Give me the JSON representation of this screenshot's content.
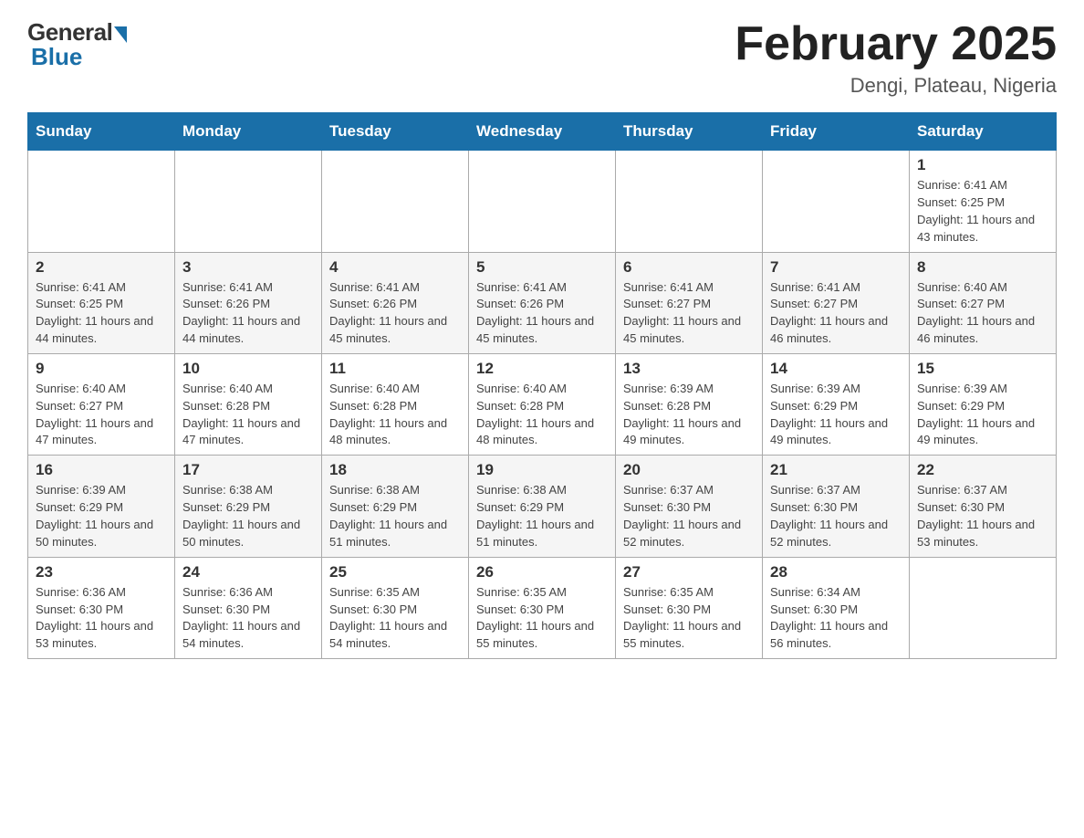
{
  "header": {
    "logo_general": "General",
    "logo_blue": "Blue",
    "month_title": "February 2025",
    "location": "Dengi, Plateau, Nigeria"
  },
  "weekdays": [
    "Sunday",
    "Monday",
    "Tuesday",
    "Wednesday",
    "Thursday",
    "Friday",
    "Saturday"
  ],
  "weeks": [
    [
      {
        "day": "",
        "sunrise": "",
        "sunset": "",
        "daylight": "",
        "empty": true
      },
      {
        "day": "",
        "sunrise": "",
        "sunset": "",
        "daylight": "",
        "empty": true
      },
      {
        "day": "",
        "sunrise": "",
        "sunset": "",
        "daylight": "",
        "empty": true
      },
      {
        "day": "",
        "sunrise": "",
        "sunset": "",
        "daylight": "",
        "empty": true
      },
      {
        "day": "",
        "sunrise": "",
        "sunset": "",
        "daylight": "",
        "empty": true
      },
      {
        "day": "",
        "sunrise": "",
        "sunset": "",
        "daylight": "",
        "empty": true
      },
      {
        "day": "1",
        "sunrise": "Sunrise: 6:41 AM",
        "sunset": "Sunset: 6:25 PM",
        "daylight": "Daylight: 11 hours and 43 minutes.",
        "empty": false
      }
    ],
    [
      {
        "day": "2",
        "sunrise": "Sunrise: 6:41 AM",
        "sunset": "Sunset: 6:25 PM",
        "daylight": "Daylight: 11 hours and 44 minutes.",
        "empty": false
      },
      {
        "day": "3",
        "sunrise": "Sunrise: 6:41 AM",
        "sunset": "Sunset: 6:26 PM",
        "daylight": "Daylight: 11 hours and 44 minutes.",
        "empty": false
      },
      {
        "day": "4",
        "sunrise": "Sunrise: 6:41 AM",
        "sunset": "Sunset: 6:26 PM",
        "daylight": "Daylight: 11 hours and 45 minutes.",
        "empty": false
      },
      {
        "day": "5",
        "sunrise": "Sunrise: 6:41 AM",
        "sunset": "Sunset: 6:26 PM",
        "daylight": "Daylight: 11 hours and 45 minutes.",
        "empty": false
      },
      {
        "day": "6",
        "sunrise": "Sunrise: 6:41 AM",
        "sunset": "Sunset: 6:27 PM",
        "daylight": "Daylight: 11 hours and 45 minutes.",
        "empty": false
      },
      {
        "day": "7",
        "sunrise": "Sunrise: 6:41 AM",
        "sunset": "Sunset: 6:27 PM",
        "daylight": "Daylight: 11 hours and 46 minutes.",
        "empty": false
      },
      {
        "day": "8",
        "sunrise": "Sunrise: 6:40 AM",
        "sunset": "Sunset: 6:27 PM",
        "daylight": "Daylight: 11 hours and 46 minutes.",
        "empty": false
      }
    ],
    [
      {
        "day": "9",
        "sunrise": "Sunrise: 6:40 AM",
        "sunset": "Sunset: 6:27 PM",
        "daylight": "Daylight: 11 hours and 47 minutes.",
        "empty": false
      },
      {
        "day": "10",
        "sunrise": "Sunrise: 6:40 AM",
        "sunset": "Sunset: 6:28 PM",
        "daylight": "Daylight: 11 hours and 47 minutes.",
        "empty": false
      },
      {
        "day": "11",
        "sunrise": "Sunrise: 6:40 AM",
        "sunset": "Sunset: 6:28 PM",
        "daylight": "Daylight: 11 hours and 48 minutes.",
        "empty": false
      },
      {
        "day": "12",
        "sunrise": "Sunrise: 6:40 AM",
        "sunset": "Sunset: 6:28 PM",
        "daylight": "Daylight: 11 hours and 48 minutes.",
        "empty": false
      },
      {
        "day": "13",
        "sunrise": "Sunrise: 6:39 AM",
        "sunset": "Sunset: 6:28 PM",
        "daylight": "Daylight: 11 hours and 49 minutes.",
        "empty": false
      },
      {
        "day": "14",
        "sunrise": "Sunrise: 6:39 AM",
        "sunset": "Sunset: 6:29 PM",
        "daylight": "Daylight: 11 hours and 49 minutes.",
        "empty": false
      },
      {
        "day": "15",
        "sunrise": "Sunrise: 6:39 AM",
        "sunset": "Sunset: 6:29 PM",
        "daylight": "Daylight: 11 hours and 49 minutes.",
        "empty": false
      }
    ],
    [
      {
        "day": "16",
        "sunrise": "Sunrise: 6:39 AM",
        "sunset": "Sunset: 6:29 PM",
        "daylight": "Daylight: 11 hours and 50 minutes.",
        "empty": false
      },
      {
        "day": "17",
        "sunrise": "Sunrise: 6:38 AM",
        "sunset": "Sunset: 6:29 PM",
        "daylight": "Daylight: 11 hours and 50 minutes.",
        "empty": false
      },
      {
        "day": "18",
        "sunrise": "Sunrise: 6:38 AM",
        "sunset": "Sunset: 6:29 PM",
        "daylight": "Daylight: 11 hours and 51 minutes.",
        "empty": false
      },
      {
        "day": "19",
        "sunrise": "Sunrise: 6:38 AM",
        "sunset": "Sunset: 6:29 PM",
        "daylight": "Daylight: 11 hours and 51 minutes.",
        "empty": false
      },
      {
        "day": "20",
        "sunrise": "Sunrise: 6:37 AM",
        "sunset": "Sunset: 6:30 PM",
        "daylight": "Daylight: 11 hours and 52 minutes.",
        "empty": false
      },
      {
        "day": "21",
        "sunrise": "Sunrise: 6:37 AM",
        "sunset": "Sunset: 6:30 PM",
        "daylight": "Daylight: 11 hours and 52 minutes.",
        "empty": false
      },
      {
        "day": "22",
        "sunrise": "Sunrise: 6:37 AM",
        "sunset": "Sunset: 6:30 PM",
        "daylight": "Daylight: 11 hours and 53 minutes.",
        "empty": false
      }
    ],
    [
      {
        "day": "23",
        "sunrise": "Sunrise: 6:36 AM",
        "sunset": "Sunset: 6:30 PM",
        "daylight": "Daylight: 11 hours and 53 minutes.",
        "empty": false
      },
      {
        "day": "24",
        "sunrise": "Sunrise: 6:36 AM",
        "sunset": "Sunset: 6:30 PM",
        "daylight": "Daylight: 11 hours and 54 minutes.",
        "empty": false
      },
      {
        "day": "25",
        "sunrise": "Sunrise: 6:35 AM",
        "sunset": "Sunset: 6:30 PM",
        "daylight": "Daylight: 11 hours and 54 minutes.",
        "empty": false
      },
      {
        "day": "26",
        "sunrise": "Sunrise: 6:35 AM",
        "sunset": "Sunset: 6:30 PM",
        "daylight": "Daylight: 11 hours and 55 minutes.",
        "empty": false
      },
      {
        "day": "27",
        "sunrise": "Sunrise: 6:35 AM",
        "sunset": "Sunset: 6:30 PM",
        "daylight": "Daylight: 11 hours and 55 minutes.",
        "empty": false
      },
      {
        "day": "28",
        "sunrise": "Sunrise: 6:34 AM",
        "sunset": "Sunset: 6:30 PM",
        "daylight": "Daylight: 11 hours and 56 minutes.",
        "empty": false
      },
      {
        "day": "",
        "sunrise": "",
        "sunset": "",
        "daylight": "",
        "empty": true
      }
    ]
  ]
}
